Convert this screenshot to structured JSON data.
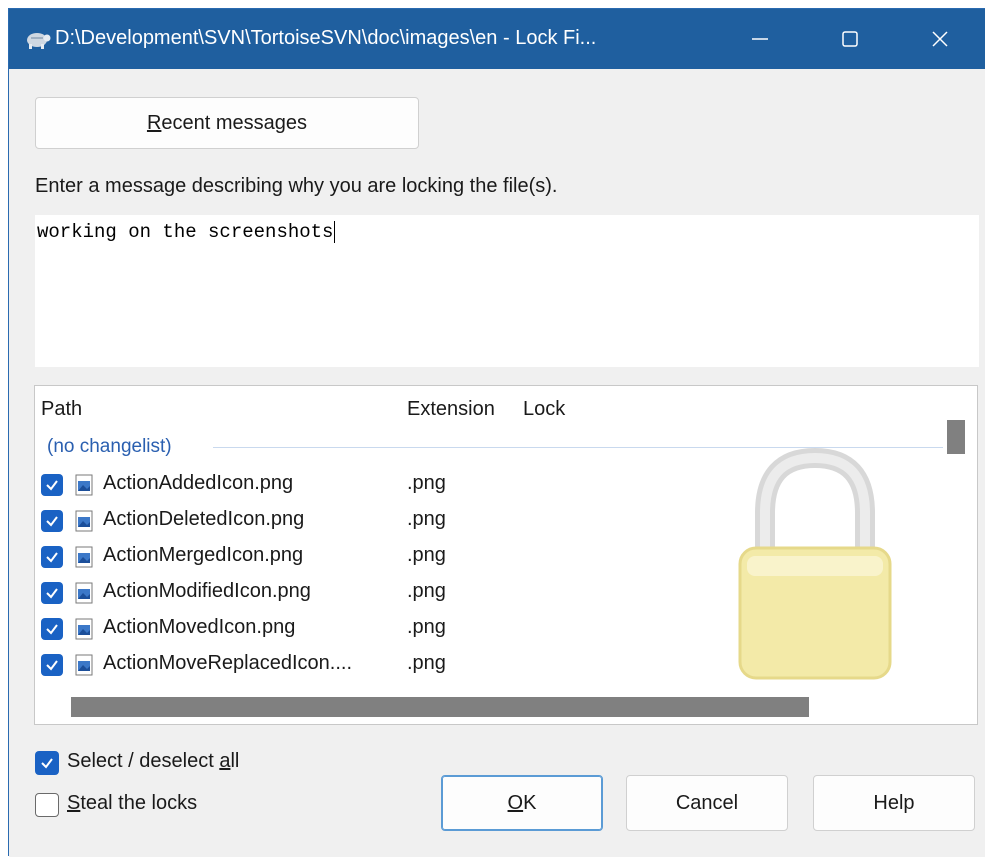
{
  "window": {
    "title": "D:\\Development\\SVN\\TortoiseSVN\\doc\\images\\en - Lock Fi...",
    "icons": [
      "tortoise-app-icon",
      "minimize-icon",
      "maximize-icon",
      "close-icon"
    ]
  },
  "recent_messages_button": {
    "prefix": "R",
    "rest": "ecent messages"
  },
  "prompt_label": "Enter a message describing why you are locking the file(s).",
  "message": {
    "value": "working on the screenshots"
  },
  "file_list": {
    "columns": {
      "path": "Path",
      "extension": "Extension",
      "lock": "Lock"
    },
    "group_label": "(no changelist)",
    "rows": [
      {
        "name": "ActionAddedIcon.png",
        "ext": ".png",
        "checked": true
      },
      {
        "name": "ActionDeletedIcon.png",
        "ext": ".png",
        "checked": true
      },
      {
        "name": "ActionMergedIcon.png",
        "ext": ".png",
        "checked": true
      },
      {
        "name": "ActionModifiedIcon.png",
        "ext": ".png",
        "checked": true
      },
      {
        "name": "ActionMovedIcon.png",
        "ext": ".png",
        "checked": true
      },
      {
        "name": "ActionMoveReplacedIcon....",
        "ext": ".png",
        "checked": true
      }
    ]
  },
  "select_all": {
    "prefix": "Select / deselect ",
    "accel": "a",
    "rest": "ll",
    "checked": true
  },
  "steal_locks": {
    "accel": "S",
    "rest": "teal the locks",
    "checked": false
  },
  "buttons": {
    "ok": {
      "accel": "O",
      "rest": "K"
    },
    "cancel": "Cancel",
    "help": "Help"
  },
  "colors": {
    "titlebar": "#1f5f9f",
    "accent": "#1a62c4",
    "group_text": "#2a5fb0"
  }
}
